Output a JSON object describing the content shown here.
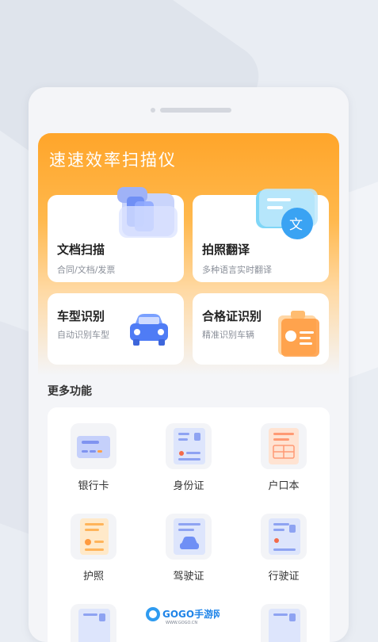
{
  "app": {
    "title": "速速效率扫描仪"
  },
  "features": [
    {
      "title": "文档扫描",
      "subtitle": "合同/文档/发票"
    },
    {
      "title": "拍照翻译",
      "subtitle": "多种语言实时翻译"
    },
    {
      "title": "车型识别",
      "subtitle": "自动识别车型"
    },
    {
      "title": "合格证识别",
      "subtitle": "精准识别车辆"
    }
  ],
  "more": {
    "title": "更多功能",
    "items": [
      {
        "label": "银行卡",
        "icon": "bank-card-icon"
      },
      {
        "label": "身份证",
        "icon": "id-card-icon"
      },
      {
        "label": "户口本",
        "icon": "household-register-icon"
      },
      {
        "label": "护照",
        "icon": "passport-icon"
      },
      {
        "label": "驾驶证",
        "icon": "driver-license-icon"
      },
      {
        "label": "行驶证",
        "icon": "vehicle-license-icon"
      }
    ]
  },
  "watermark": {
    "text": "GOGO手游网",
    "sub": "WWW.GOGO.CN"
  },
  "colors": {
    "accent": "#ffa52a",
    "blue": "#6f8ff5",
    "orange": "#ff9a3d"
  }
}
